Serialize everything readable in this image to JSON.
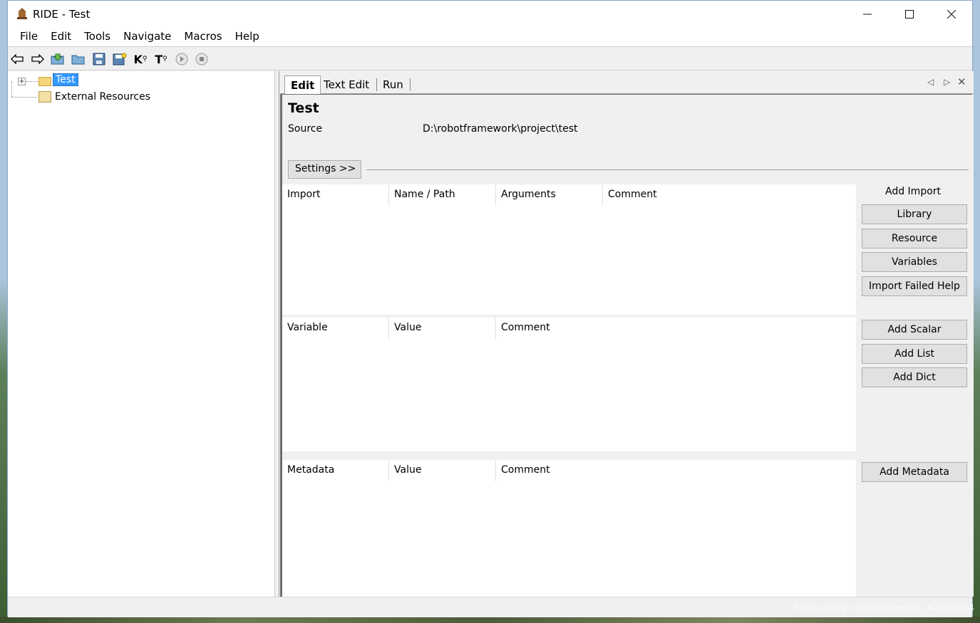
{
  "window": {
    "title": "RIDE - Test"
  },
  "menu": [
    "File",
    "Edit",
    "Tools",
    "Navigate",
    "Macros",
    "Help"
  ],
  "toolbar_icons": [
    "back-arrow-icon",
    "forward-arrow-icon",
    "open-test-suite-icon",
    "open-directory-icon",
    "save-icon",
    "save-all-icon",
    "search-keywords-icon",
    "search-tests-icon",
    "run-icon",
    "stop-icon"
  ],
  "tree": {
    "root": "Test",
    "external": "External Resources"
  },
  "tabs": [
    "Edit",
    "Text Edit",
    "Run"
  ],
  "page": {
    "title": "Test",
    "source_label": "Source",
    "source_value": "D:\\robotframework\\project\\test",
    "settings_button": "Settings >>"
  },
  "import_grid": {
    "headers": [
      "Import",
      "Name / Path",
      "Arguments",
      "Comment"
    ]
  },
  "variable_grid": {
    "headers": [
      "Variable",
      "Value",
      "Comment"
    ]
  },
  "metadata_grid": {
    "headers": [
      "Metadata",
      "Value",
      "Comment"
    ]
  },
  "import_actions": {
    "label": "Add Import",
    "buttons": [
      "Library",
      "Resource",
      "Variables",
      "Import Failed Help"
    ]
  },
  "variable_actions": {
    "buttons": [
      "Add Scalar",
      "Add List",
      "Add Dict"
    ]
  },
  "metadata_actions": {
    "buttons": [
      "Add Metadata"
    ]
  },
  "watermark": "https://blog.csdn.net/weixin_42069964"
}
